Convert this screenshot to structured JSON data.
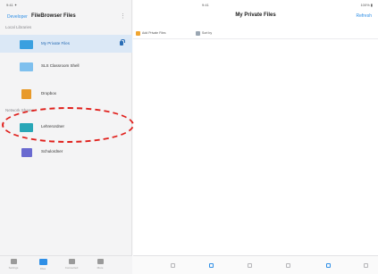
{
  "status_bar": {
    "left": "9:41 ✦",
    "center": "9:41",
    "right": "100% ▮"
  },
  "sidebar": {
    "back_label": "Developer",
    "title": "FileBrowser Files",
    "edit_label": "⋮",
    "local_section": "Local Libraries",
    "items": [
      {
        "label": "My Private Files",
        "icon": "folder-icon",
        "color": "#3aa0e0",
        "selected": true
      },
      {
        "label": "SLS Classroom Shell",
        "icon": "folder-icon",
        "color": "#7fc0ee",
        "selected": false
      },
      {
        "label": "Dropbox",
        "icon": "dropbox-icon",
        "color": "#e89a2a",
        "selected": false
      }
    ],
    "network_section": "Network Shares",
    "network_items": [
      {
        "label": "Lehrerordner",
        "icon": "network-drive-icon",
        "color": "#29a7b7"
      },
      {
        "label": "Schulordner",
        "icon": "network-drive-icon",
        "color": "#6a6ad0"
      }
    ],
    "toolbar": [
      {
        "label": "Settings",
        "icon": "gear-icon"
      },
      {
        "label": "Files",
        "icon": "folder-icon"
      },
      {
        "label": "Connected",
        "icon": "network-icon"
      },
      {
        "label": "More",
        "icon": "more-icon"
      }
    ]
  },
  "main": {
    "title": "My Private Files",
    "action_label": "Refresh",
    "chips": [
      {
        "label": "Add Private Files",
        "color": "#f0a530"
      },
      {
        "label": "Sort by",
        "color": "#9aa6b2"
      }
    ]
  },
  "colors": {
    "accent": "#2f8fe6",
    "selected_bg": "#dbe8f6",
    "annotation": "#e0201c"
  }
}
